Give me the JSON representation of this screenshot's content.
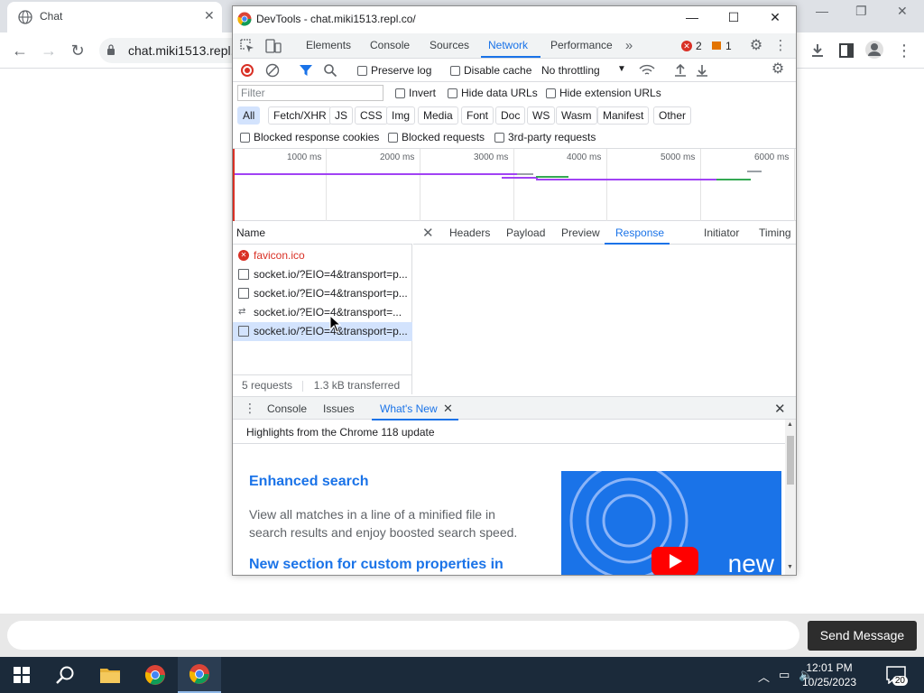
{
  "browser": {
    "tab_title": "Chat",
    "url": "chat.miki1513.repl."
  },
  "chat": {
    "send_label": "Send Message",
    "input_placeholder": ""
  },
  "devtools": {
    "window_title": "DevTools - chat.miki1513.repl.co/",
    "tabs": [
      "Elements",
      "Console",
      "Sources",
      "Network",
      "Performance"
    ],
    "active_tab": "Network",
    "errors_count": "2",
    "warnings_count": "1",
    "toolbar": {
      "preserve_log": "Preserve log",
      "disable_cache": "Disable cache",
      "throttling": "No throttling"
    },
    "filter": {
      "placeholder": "Filter",
      "invert": "Invert",
      "hide_data_urls": "Hide data URLs",
      "hide_extension_urls": "Hide extension URLs"
    },
    "type_filters": [
      "All",
      "Fetch/XHR",
      "JS",
      "CSS",
      "Img",
      "Media",
      "Font",
      "Doc",
      "WS",
      "Wasm",
      "Manifest",
      "Other"
    ],
    "blocked": {
      "response_cookies": "Blocked response cookies",
      "requests": "Blocked requests",
      "third_party": "3rd-party requests"
    },
    "timeline_labels": [
      "1000 ms",
      "2000 ms",
      "3000 ms",
      "4000 ms",
      "5000 ms",
      "6000 ms"
    ],
    "name_header": "Name",
    "requests": [
      {
        "name": "favicon.ico",
        "type": "error"
      },
      {
        "name": "socket.io/?EIO=4&transport=p...",
        "type": "doc"
      },
      {
        "name": "socket.io/?EIO=4&transport=p...",
        "type": "doc"
      },
      {
        "name": "socket.io/?EIO=4&transport=...",
        "type": "ws"
      },
      {
        "name": "socket.io/?EIO=4&transport=p...",
        "type": "doc"
      }
    ],
    "summary": {
      "requests": "5 requests",
      "transferred": "1.3 kB transferred"
    },
    "detail_tabs": [
      "Headers",
      "Payload",
      "Preview",
      "Response",
      "Initiator",
      "Timing"
    ],
    "active_detail_tab": "Response",
    "drawer": {
      "tabs": [
        "Console",
        "Issues",
        "What's New"
      ],
      "active": "What's New",
      "headline": "Highlights from the Chrome 118 update",
      "section1_title": "Enhanced search",
      "section1_text": "View all matches in a line of a minified file in search results and enjoy boosted search speed.",
      "section2_title": "New section for custom properties in",
      "image_text": "new"
    }
  },
  "taskbar": {
    "time": "12:01 PM",
    "date": "10/25/2023",
    "notifications": "20"
  },
  "colors": {
    "accent": "#1a73e8",
    "error": "#d93025",
    "taskbar": "#1b2a3a"
  }
}
